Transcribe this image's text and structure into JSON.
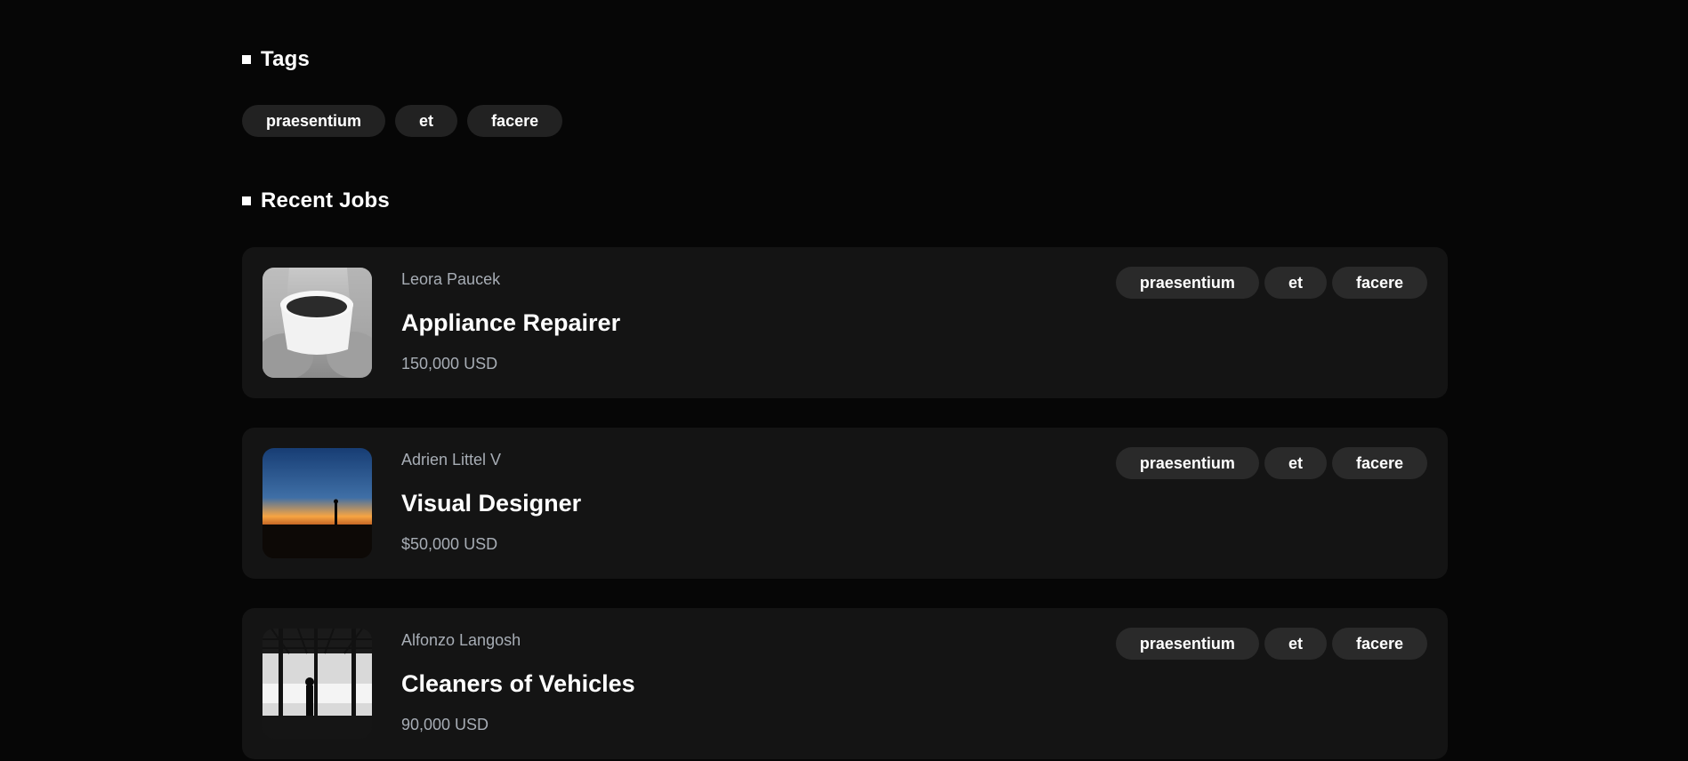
{
  "tags_section": {
    "heading": "Tags",
    "tags": [
      "praesentium",
      "et",
      "facere"
    ]
  },
  "jobs_section": {
    "heading": "Recent Jobs",
    "jobs": [
      {
        "company": "Leora Paucek",
        "title": "Appliance Repairer",
        "salary": "150,000 USD",
        "tags": [
          "praesentium",
          "et",
          "facere"
        ],
        "thumbnail": "coffee-cup-image"
      },
      {
        "company": "Adrien Littel V",
        "title": "Visual Designer",
        "salary": "$50,000 USD",
        "tags": [
          "praesentium",
          "et",
          "facere"
        ],
        "thumbnail": "sunset-silhouette-image"
      },
      {
        "company": "Alfonzo Langosh",
        "title": "Cleaners of Vehicles",
        "salary": "90,000 USD",
        "tags": [
          "praesentium",
          "et",
          "facere"
        ],
        "thumbnail": "window-silhouette-image"
      }
    ]
  },
  "colors": {
    "background": "#060606",
    "card": "#141414",
    "pill": "#222222",
    "muted_text": "#a7adb5"
  }
}
